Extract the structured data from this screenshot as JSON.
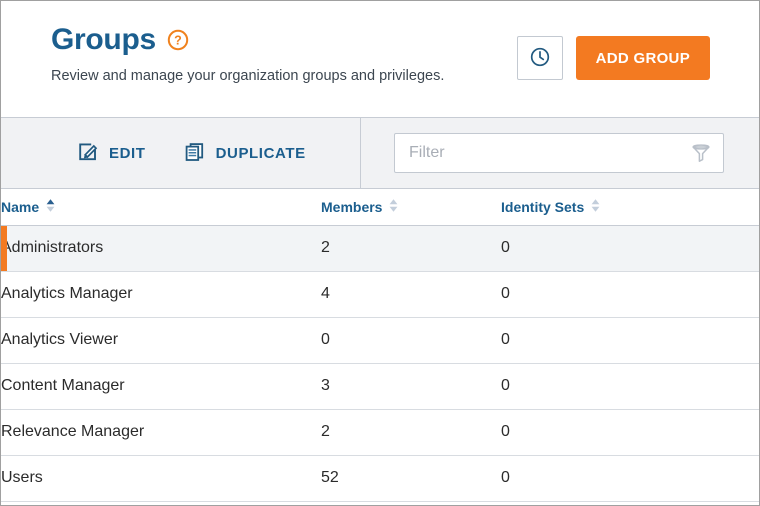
{
  "header": {
    "title": "Groups",
    "help_icon": "help-circle-icon",
    "subtitle": "Review and manage your organization groups and privileges.",
    "history_button": {
      "icon": "clock-icon",
      "label": ""
    },
    "add_button": {
      "label": "ADD GROUP"
    }
  },
  "toolbar": {
    "edit": {
      "label": "EDIT",
      "icon": "edit-pencil-square-icon"
    },
    "duplicate": {
      "label": "DUPLICATE",
      "icon": "copy-documents-icon"
    },
    "filter": {
      "value": "",
      "placeholder": "Filter",
      "icon": "funnel-filter-icon"
    }
  },
  "table": {
    "columns": [
      {
        "label": "Name",
        "sort": "asc",
        "sort_icon": "sort-arrows-icon"
      },
      {
        "label": "Members",
        "sort": "none",
        "sort_icon": "sort-arrows-icon"
      },
      {
        "label": "Identity Sets",
        "sort": "none",
        "sort_icon": "sort-arrows-icon"
      }
    ],
    "rows": [
      {
        "name": "Administrators",
        "members": "2",
        "identity_sets": "0",
        "selected": true
      },
      {
        "name": "Analytics Manager",
        "members": "4",
        "identity_sets": "0",
        "selected": false
      },
      {
        "name": "Analytics Viewer",
        "members": "0",
        "identity_sets": "0",
        "selected": false
      },
      {
        "name": "Content Manager",
        "members": "3",
        "identity_sets": "0",
        "selected": false
      },
      {
        "name": "Relevance Manager",
        "members": "2",
        "identity_sets": "0",
        "selected": false
      },
      {
        "name": "Users",
        "members": "52",
        "identity_sets": "0",
        "selected": false
      }
    ]
  },
  "colors": {
    "accent_orange": "#f37a21",
    "brand_blue": "#1b5e8e",
    "toolbar_bg": "#f1f2f4",
    "selected_row_bg": "#f2f4f6",
    "border": "#c7ccd4"
  }
}
